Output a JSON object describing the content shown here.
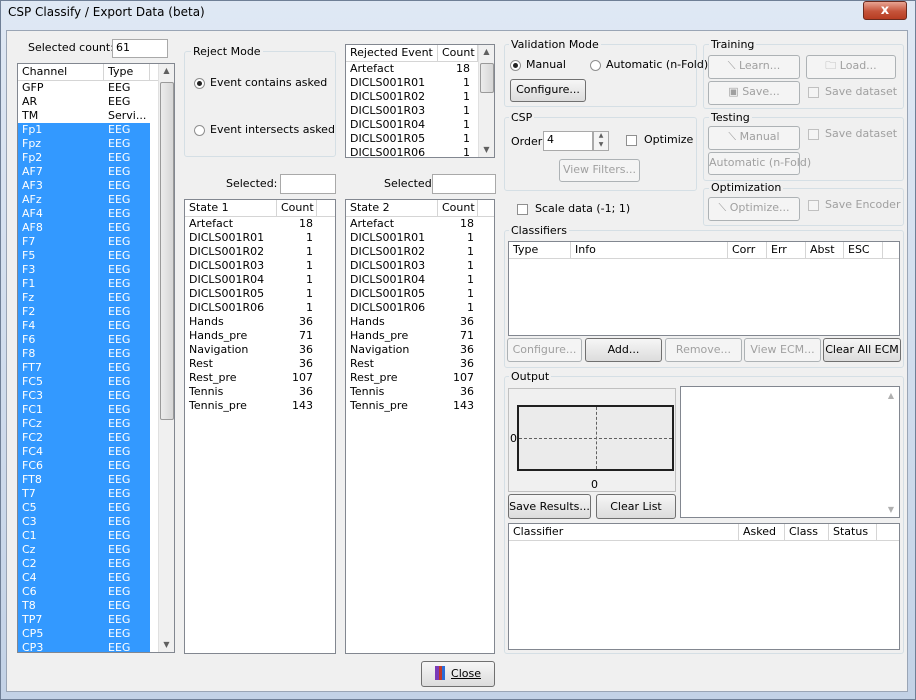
{
  "window": {
    "title": "CSP Classify / Export Data (beta)",
    "close_glyph": "x"
  },
  "channels": {
    "selected_count_label": "Selected count:",
    "selected_count_value": "61",
    "col_channel": "Channel",
    "col_type": "Type",
    "rows": [
      {
        "name": "GFP",
        "type": "EEG",
        "sel": false
      },
      {
        "name": "AR",
        "type": "EEG",
        "sel": false
      },
      {
        "name": "TM",
        "type": "Servi...",
        "sel": false
      },
      {
        "name": "Fp1",
        "type": "EEG",
        "sel": true
      },
      {
        "name": "Fpz",
        "type": "EEG",
        "sel": true
      },
      {
        "name": "Fp2",
        "type": "EEG",
        "sel": true
      },
      {
        "name": "AF7",
        "type": "EEG",
        "sel": true
      },
      {
        "name": "AF3",
        "type": "EEG",
        "sel": true
      },
      {
        "name": "AFz",
        "type": "EEG",
        "sel": true
      },
      {
        "name": "AF4",
        "type": "EEG",
        "sel": true
      },
      {
        "name": "AF8",
        "type": "EEG",
        "sel": true
      },
      {
        "name": "F7",
        "type": "EEG",
        "sel": true
      },
      {
        "name": "F5",
        "type": "EEG",
        "sel": true
      },
      {
        "name": "F3",
        "type": "EEG",
        "sel": true
      },
      {
        "name": "F1",
        "type": "EEG",
        "sel": true
      },
      {
        "name": "Fz",
        "type": "EEG",
        "sel": true
      },
      {
        "name": "F2",
        "type": "EEG",
        "sel": true
      },
      {
        "name": "F4",
        "type": "EEG",
        "sel": true
      },
      {
        "name": "F6",
        "type": "EEG",
        "sel": true
      },
      {
        "name": "F8",
        "type": "EEG",
        "sel": true
      },
      {
        "name": "FT7",
        "type": "EEG",
        "sel": true
      },
      {
        "name": "FC5",
        "type": "EEG",
        "sel": true
      },
      {
        "name": "FC3",
        "type": "EEG",
        "sel": true
      },
      {
        "name": "FC1",
        "type": "EEG",
        "sel": true
      },
      {
        "name": "FCz",
        "type": "EEG",
        "sel": true
      },
      {
        "name": "FC2",
        "type": "EEG",
        "sel": true
      },
      {
        "name": "FC4",
        "type": "EEG",
        "sel": true
      },
      {
        "name": "FC6",
        "type": "EEG",
        "sel": true
      },
      {
        "name": "FT8",
        "type": "EEG",
        "sel": true
      },
      {
        "name": "T7",
        "type": "EEG",
        "sel": true
      },
      {
        "name": "C5",
        "type": "EEG",
        "sel": true
      },
      {
        "name": "C3",
        "type": "EEG",
        "sel": true
      },
      {
        "name": "C1",
        "type": "EEG",
        "sel": true
      },
      {
        "name": "Cz",
        "type": "EEG",
        "sel": true
      },
      {
        "name": "C2",
        "type": "EEG",
        "sel": true
      },
      {
        "name": "C4",
        "type": "EEG",
        "sel": true
      },
      {
        "name": "C6",
        "type": "EEG",
        "sel": true
      },
      {
        "name": "T8",
        "type": "EEG",
        "sel": true
      },
      {
        "name": "TP7",
        "type": "EEG",
        "sel": true
      },
      {
        "name": "CP5",
        "type": "EEG",
        "sel": true
      },
      {
        "name": "CP3",
        "type": "EEG",
        "sel": true
      }
    ]
  },
  "reject_mode": {
    "title": "Reject Mode",
    "option_contains": "Event contains asked",
    "option_intersects": "Event intersects asked"
  },
  "rejected_events": {
    "col_event": "Rejected Event",
    "col_count": "Count",
    "rows": [
      {
        "name": "Artefact",
        "count": "18"
      },
      {
        "name": "DICLS001R01",
        "count": "1"
      },
      {
        "name": "DICLS001R02",
        "count": "1"
      },
      {
        "name": "DICLS001R03",
        "count": "1"
      },
      {
        "name": "DICLS001R04",
        "count": "1"
      },
      {
        "name": "DICLS001R05",
        "count": "1"
      },
      {
        "name": "DICLS001R06",
        "count": "1"
      }
    ]
  },
  "state1": {
    "selected_label": "Selected:",
    "col_state": "State 1",
    "col_count": "Count",
    "rows": [
      {
        "name": "Artefact",
        "count": "18"
      },
      {
        "name": "DICLS001R01",
        "count": "1"
      },
      {
        "name": "DICLS001R02",
        "count": "1"
      },
      {
        "name": "DICLS001R03",
        "count": "1"
      },
      {
        "name": "DICLS001R04",
        "count": "1"
      },
      {
        "name": "DICLS001R05",
        "count": "1"
      },
      {
        "name": "DICLS001R06",
        "count": "1"
      },
      {
        "name": "Hands",
        "count": "36"
      },
      {
        "name": "Hands_pre",
        "count": "71"
      },
      {
        "name": "Navigation",
        "count": "36"
      },
      {
        "name": "Rest",
        "count": "36"
      },
      {
        "name": "Rest_pre",
        "count": "107"
      },
      {
        "name": "Tennis",
        "count": "36"
      },
      {
        "name": "Tennis_pre",
        "count": "143"
      }
    ]
  },
  "state2": {
    "selected_label": "Selected:",
    "col_state": "State 2",
    "col_count": "Count",
    "rows": [
      {
        "name": "Artefact",
        "count": "18"
      },
      {
        "name": "DICLS001R01",
        "count": "1"
      },
      {
        "name": "DICLS001R02",
        "count": "1"
      },
      {
        "name": "DICLS001R03",
        "count": "1"
      },
      {
        "name": "DICLS001R04",
        "count": "1"
      },
      {
        "name": "DICLS001R05",
        "count": "1"
      },
      {
        "name": "DICLS001R06",
        "count": "1"
      },
      {
        "name": "Hands",
        "count": "36"
      },
      {
        "name": "Hands_pre",
        "count": "71"
      },
      {
        "name": "Navigation",
        "count": "36"
      },
      {
        "name": "Rest",
        "count": "36"
      },
      {
        "name": "Rest_pre",
        "count": "107"
      },
      {
        "name": "Tennis",
        "count": "36"
      },
      {
        "name": "Tennis_pre",
        "count": "143"
      }
    ]
  },
  "validation": {
    "title": "Validation Mode",
    "manual": "Manual",
    "automatic": "Automatic (n-Fold)",
    "configure": "Configure..."
  },
  "csp": {
    "title": "CSP",
    "order_label": "Order:",
    "order_value": "4",
    "optimize": "Optimize",
    "view_filters": "View Filters...",
    "scale_data": "Scale data (-1; 1)"
  },
  "training": {
    "title": "Training",
    "learn": "Learn...",
    "load": "Load...",
    "save": "Save...",
    "save_dataset": "Save dataset"
  },
  "testing": {
    "title": "Testing",
    "manual": "Manual",
    "automatic": "Automatic (n-Fold)",
    "save_dataset": "Save dataset"
  },
  "optimization": {
    "title": "Optimization",
    "optimize": "Optimize...",
    "save_encoder": "Save Encoder"
  },
  "classifiers": {
    "title": "Classifiers",
    "cols": [
      "Type",
      "Info",
      "Corr",
      "Err",
      "Abst",
      "ESC"
    ],
    "configure": "Configure...",
    "add": "Add...",
    "remove": "Remove...",
    "view_ecm": "View ECM...",
    "clear_all_ecm": "Clear All ECM"
  },
  "output": {
    "title": "Output",
    "axis_y_label": "0",
    "axis_x_label": "0",
    "save_results": "Save Results...",
    "clear_list": "Clear List",
    "cols": [
      "Classifier",
      "Asked",
      "Class",
      "Status"
    ]
  },
  "footer": {
    "close": "Close"
  }
}
